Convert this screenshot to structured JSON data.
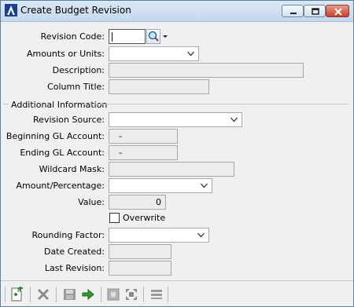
{
  "window": {
    "title": "Create Budget Revision"
  },
  "form": {
    "revision_code": {
      "label": "Revision Code:",
      "value": ""
    },
    "amounts_or_units": {
      "label": "Amounts or Units:",
      "value": ""
    },
    "description": {
      "label": "Description:",
      "value": ""
    },
    "column_title": {
      "label": "Column Title:",
      "value": ""
    }
  },
  "additional": {
    "section_label": "Additional Information",
    "revision_source": {
      "label": "Revision Source:",
      "value": ""
    },
    "beginning_gl": {
      "label": "Beginning GL Account:",
      "value": "-"
    },
    "ending_gl": {
      "label": "Ending GL Account:",
      "value": "-"
    },
    "wildcard_mask": {
      "label": "Wildcard Mask:",
      "value": ""
    },
    "amount_percentage": {
      "label": "Amount/Percentage:",
      "value": ""
    },
    "value": {
      "label": "Value:",
      "value": "0"
    },
    "overwrite": {
      "label": "Overwrite",
      "checked": false
    },
    "rounding_factor": {
      "label": "Rounding Factor:",
      "value": ""
    },
    "date_created": {
      "label": "Date Created:",
      "value": ""
    },
    "last_revision": {
      "label": "Last Revision:",
      "value": ""
    }
  },
  "toolbar": {
    "icons": [
      "new-document-icon",
      "delete-icon",
      "save-icon",
      "go-arrow-icon",
      "collapse-icon",
      "expand-icon",
      "list-icon"
    ]
  },
  "colors": {
    "titlebar": "#c5d8ec",
    "close_button": "#c7412c",
    "accent_green": "#2e8b2e"
  }
}
